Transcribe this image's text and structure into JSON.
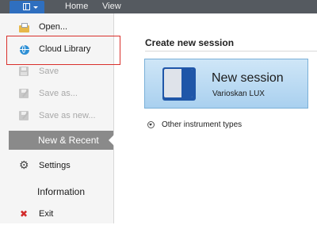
{
  "topbar": {
    "app_menu_icon": "document-menu-icon",
    "tabs": [
      {
        "label": "Home"
      },
      {
        "label": "View"
      }
    ]
  },
  "file_menu": {
    "items": [
      {
        "label": "Open...",
        "icon": "folder-open-icon",
        "enabled": true
      },
      {
        "label": "Cloud Library",
        "icon": "globe-icon",
        "enabled": true,
        "highlighted": true
      },
      {
        "label": "Save",
        "icon": "save-icon",
        "enabled": false
      },
      {
        "label": "Save as...",
        "icon": "save-as-icon",
        "enabled": false
      },
      {
        "label": "Save as new...",
        "icon": "save-as-new-icon",
        "enabled": false
      }
    ],
    "section_selected": "New & Recent",
    "settings_label": "Settings",
    "information_label": "Information",
    "exit_label": "Exit"
  },
  "main": {
    "title": "Create new session",
    "new_session": {
      "title": "New session",
      "subtitle": "Varioskan LUX",
      "icon": "instrument-icon"
    },
    "other_instruments_label": "Other instrument types"
  },
  "colors": {
    "topbar": "#555a60",
    "app_button": "#2f6fbf",
    "section_selected": "#8a8a8a",
    "highlight_frame": "#d9302c",
    "tile_bg": "#bcdcf3"
  }
}
